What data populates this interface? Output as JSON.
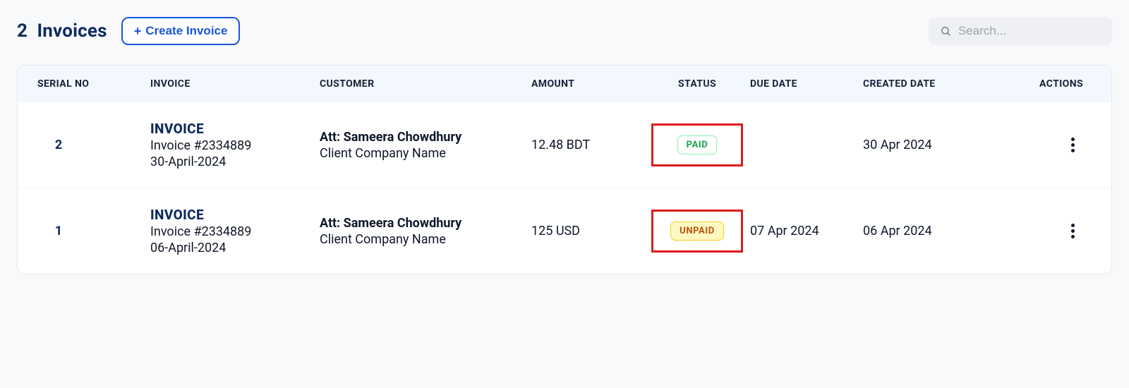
{
  "header": {
    "count": "2",
    "title": "Invoices",
    "create_label": "Create Invoice"
  },
  "search": {
    "placeholder": "Search..."
  },
  "columns": {
    "serial": "SERIAL NO",
    "invoice": "INVOICE",
    "customer": "CUSTOMER",
    "amount": "AMOUNT",
    "status": "STATUS",
    "due": "DUE DATE",
    "created": "CREATED DATE",
    "actions": "ACTIONS"
  },
  "rows": [
    {
      "serial": "2",
      "inv_title": "INVOICE",
      "inv_num": "Invoice #2334889",
      "inv_date": "30-April-2024",
      "customer_att": "Att: Sameera Chowdhury",
      "customer_company": "Client Company Name",
      "amount": "12.48 BDT",
      "status_label": "PAID",
      "status_variant": "green",
      "due": "",
      "created": "30 Apr 2024"
    },
    {
      "serial": "1",
      "inv_title": "INVOICE",
      "inv_num": "Invoice #2334889",
      "inv_date": "06-April-2024",
      "customer_att": "Att: Sameera Chowdhury",
      "customer_company": "Client Company Name",
      "amount": "125 USD",
      "status_label": "UNPAID",
      "status_variant": "amber",
      "due": "07 Apr 2024",
      "created": "06 Apr 2024"
    }
  ]
}
